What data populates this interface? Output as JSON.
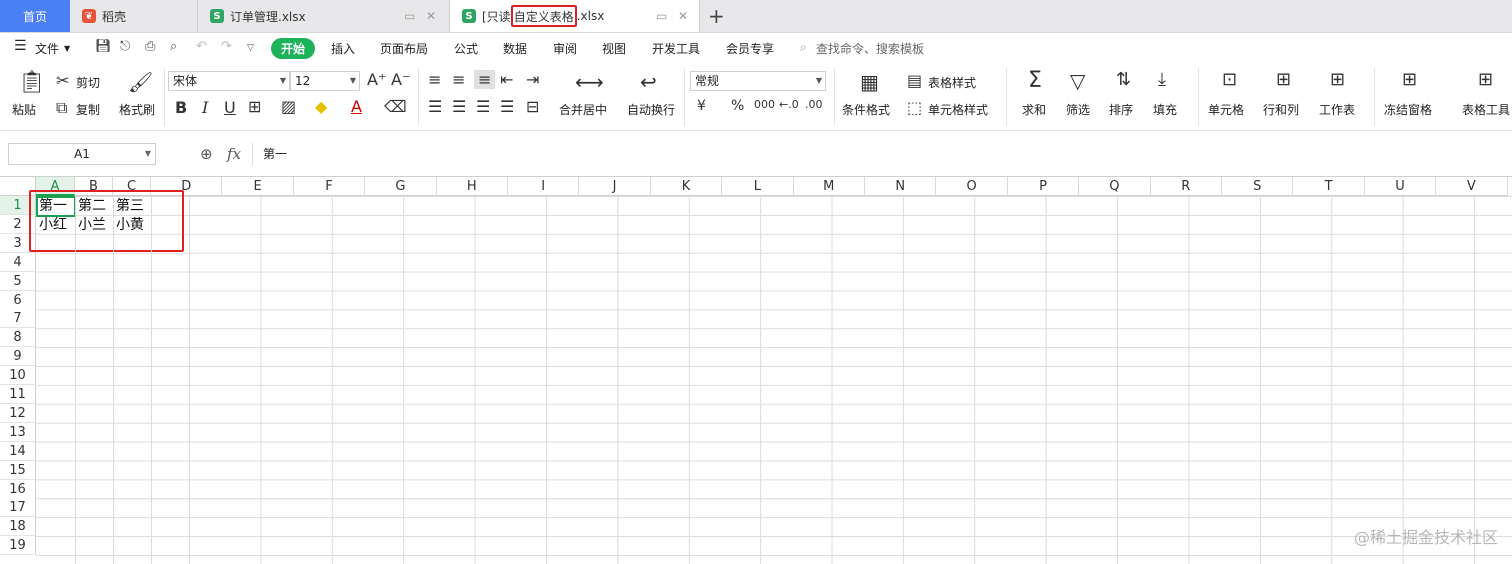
{
  "tabs": {
    "home": "首页",
    "daoke": "稻壳",
    "doc1": "订单管理.xlsx",
    "doc2_prefix": "[只读",
    "doc2_highlight": "自定义表格",
    "doc2_suffix": ".xlsx"
  },
  "menu": {
    "file": "文件",
    "items": [
      "开始",
      "插入",
      "页面布局",
      "公式",
      "数据",
      "审阅",
      "视图",
      "开发工具",
      "会员专享"
    ],
    "search": "查找命令、搜索模板"
  },
  "ribbon": {
    "paste": "粘贴",
    "cut": "剪切",
    "copy": "复制",
    "format_painter": "格式刷",
    "font_name": "宋体",
    "font_size": "12",
    "merge_center": "合并居中",
    "wrap_text": "自动换行",
    "number_format": "常规",
    "table_style": "表格样式",
    "conditional_format": "条件格式",
    "cell_style": "单元格样式",
    "sum": "求和",
    "filter": "筛选",
    "sort": "排序",
    "fill": "填充",
    "cell": "单元格",
    "row_col": "行和列",
    "worksheet": "工作表",
    "freeze": "冻结窗格",
    "table_tools": "表格工具",
    "bold": "B",
    "italic": "I",
    "underline": "U",
    "font_color": "A",
    "currency": "¥",
    "percent": "%",
    "thousands": "000"
  },
  "formula_bar": {
    "cell_ref": "A1",
    "fx": "fx",
    "content": "第一"
  },
  "sheet": {
    "columns": [
      "A",
      "B",
      "C",
      "D",
      "E",
      "F",
      "G",
      "H",
      "I",
      "J",
      "K",
      "L",
      "M",
      "N",
      "O",
      "P",
      "Q",
      "R",
      "S",
      "T",
      "U",
      "V"
    ],
    "rows": [
      "1",
      "2",
      "3",
      "4",
      "5",
      "6",
      "7",
      "8",
      "9",
      "10",
      "11",
      "12",
      "13",
      "14",
      "15",
      "16",
      "17",
      "18",
      "19"
    ],
    "cells": {
      "A1": "第一",
      "B1": "第二",
      "C1": "第三",
      "A2": "小红",
      "B2": "小兰",
      "C2": "小黄"
    }
  },
  "watermark": "@稀土掘金技术社区",
  "colors": {
    "accent_green": "#1db35a",
    "home_tab": "#4b7ff5",
    "highlight_red": "#e02020"
  }
}
